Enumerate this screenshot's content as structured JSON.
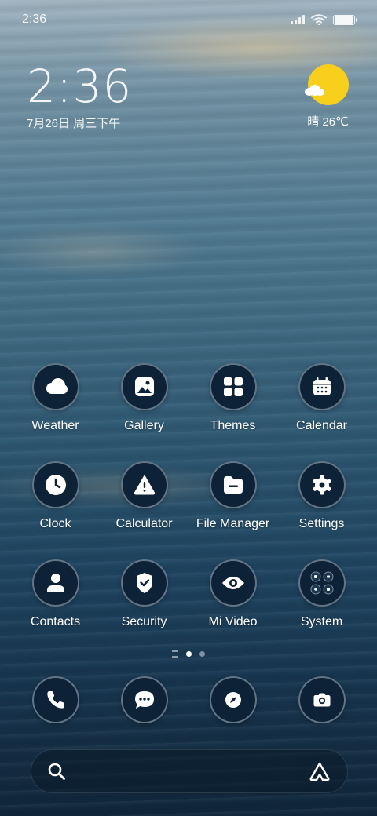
{
  "status_bar": {
    "time": "2:36",
    "battery_level": 0.95
  },
  "clock_widget": {
    "time": "2:36",
    "date": "7月26日 周三下午"
  },
  "weather_widget": {
    "text": "晴 26℃",
    "icon": "sun-cloud-icon",
    "sun_color": "#f8cf1c"
  },
  "apps": [
    [
      {
        "label": "Weather",
        "icon": "weather-icon"
      },
      {
        "label": "Gallery",
        "icon": "gallery-icon"
      },
      {
        "label": "Themes",
        "icon": "themes-icon"
      },
      {
        "label": "Calendar",
        "icon": "calendar-icon"
      }
    ],
    [
      {
        "label": "Clock",
        "icon": "clock-icon"
      },
      {
        "label": "Calculator",
        "icon": "calculator-icon"
      },
      {
        "label": "File Manager",
        "icon": "file-manager-icon"
      },
      {
        "label": "Settings",
        "icon": "gear-icon"
      }
    ],
    [
      {
        "label": "Contacts",
        "icon": "contacts-icon"
      },
      {
        "label": "Security",
        "icon": "shield-icon"
      },
      {
        "label": "Mi Video",
        "icon": "eye-icon"
      },
      {
        "label": "System",
        "icon": "folder-grid-icon"
      }
    ]
  ],
  "page_indicator": {
    "pages": 2,
    "current": 1
  },
  "dock": [
    {
      "icon": "phone-icon"
    },
    {
      "icon": "message-icon"
    },
    {
      "icon": "compass-icon"
    },
    {
      "icon": "camera-icon"
    }
  ],
  "search_bar": {
    "left_icon": "search-icon",
    "right_icon": "assistant-icon"
  },
  "colors": {
    "icon_bg": "#0d2236",
    "icon_ring": "#aab9c8"
  }
}
